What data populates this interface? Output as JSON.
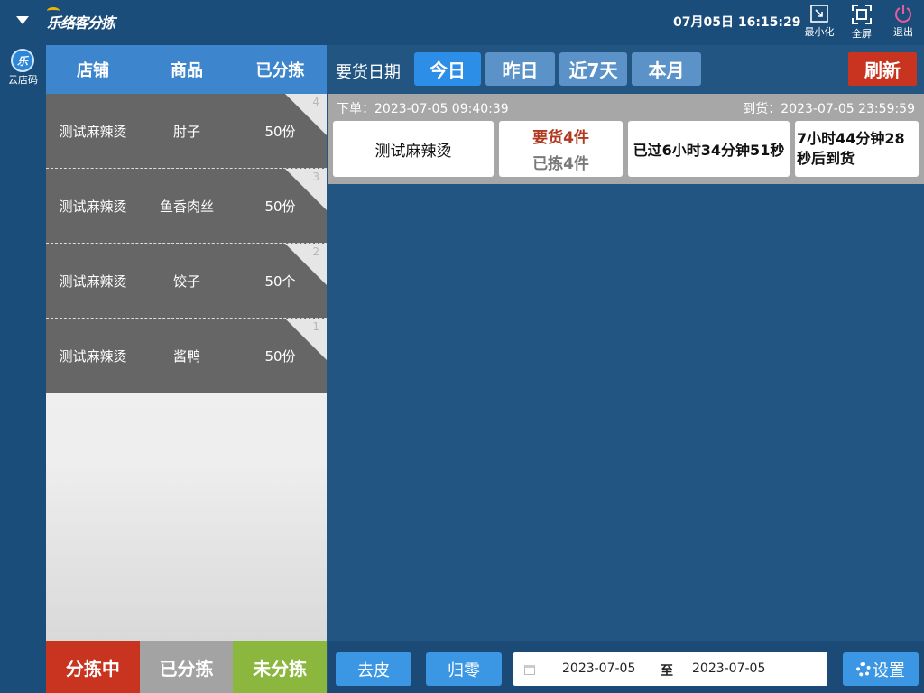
{
  "app": {
    "logo_text": "乐络客分拣",
    "datetime": "07月05日 16:15:29"
  },
  "window_controls": {
    "minimize": "最小化",
    "fullscreen": "全屏",
    "exit": "退出"
  },
  "rail": {
    "icon_text": "乐",
    "label": "云店码"
  },
  "list": {
    "headers": [
      "店铺",
      "商品",
      "已分拣"
    ],
    "rows": [
      {
        "store": "测试麻辣烫",
        "product": "肘子",
        "qty": "50份",
        "num": "4"
      },
      {
        "store": "测试麻辣烫",
        "product": "鱼香肉丝",
        "qty": "50份",
        "num": "3"
      },
      {
        "store": "测试麻辣烫",
        "product": "饺子",
        "qty": "50个",
        "num": "2"
      },
      {
        "store": "测试麻辣烫",
        "product": "酱鸭",
        "qty": "50份",
        "num": "1"
      }
    ]
  },
  "bottom_tabs": {
    "sorting": "分拣中",
    "sorted": "已分拣",
    "unsorted": "未分拣"
  },
  "filter": {
    "label": "要货日期",
    "chips": [
      "今日",
      "昨日",
      "近7天",
      "本月"
    ],
    "active_chip": "今日",
    "refresh": "刷新"
  },
  "order": {
    "order_time": "下单：2023-07-05 09:40:39",
    "arrive_time": "到货：2023-07-05 23:59:59",
    "store": "测试麻辣烫",
    "required": "要货4件",
    "sorted": "已拣4件",
    "elapsed": "已过6小时34分钟51秒",
    "remaining_line1": "7小时44分钟28",
    "remaining_line2": "秒后到货"
  },
  "footer": {
    "tare": "去皮",
    "zero": "归零",
    "date_from": "2023-07-05",
    "date_sep": "至",
    "date_to": "2023-07-05",
    "settings": "设置"
  },
  "colors": {
    "accent_blue": "#2d8ee8",
    "danger_red": "#c8341f",
    "success_green": "#8cb73e",
    "bg": "#225582"
  }
}
